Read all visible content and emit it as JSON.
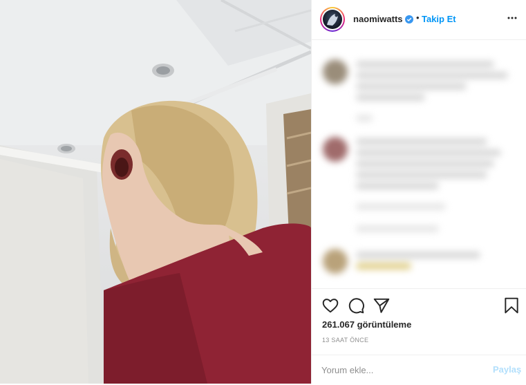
{
  "post": {
    "username": "naomiwatts",
    "separator": "•",
    "follow_label": "Takip Et",
    "views": "261.067 görüntüleme",
    "time_ago": "13 SAAT ÖNCE"
  },
  "comment_box": {
    "placeholder": "Yorum ekle...",
    "post_label": "Paylaş"
  },
  "icons": {
    "verified": "verified-badge-icon",
    "more": "more-options-icon",
    "like": "heart-icon",
    "comment": "comment-bubble-icon",
    "share": "paper-plane-icon",
    "save": "bookmark-icon"
  },
  "colors": {
    "accent": "#0095f6",
    "disabled_accent": "#b2dffc",
    "secondary_text": "#8e8e8e",
    "primary_text": "#262626"
  }
}
